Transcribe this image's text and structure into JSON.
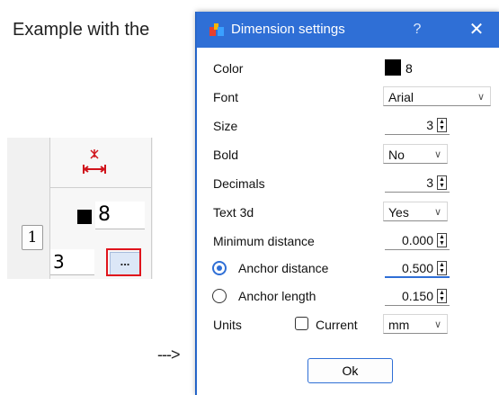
{
  "background": {
    "heading": "Example with the",
    "arrow_text": "--->",
    "table": {
      "row_number": "1",
      "color_value": "8",
      "size_value": "3",
      "more_button": "..."
    }
  },
  "dialog": {
    "title": "Dimension settings",
    "help": "?",
    "close": "✕",
    "rows": {
      "color": {
        "label": "Color",
        "value": "8",
        "swatch_color": "#000000"
      },
      "font": {
        "label": "Font",
        "value": "Arial"
      },
      "size": {
        "label": "Size",
        "value": "3"
      },
      "bold": {
        "label": "Bold",
        "value": "No"
      },
      "decimals": {
        "label": "Decimals",
        "value": "3"
      },
      "text3d": {
        "label": "Text 3d",
        "value": "Yes"
      },
      "min_distance": {
        "label": "Minimum distance",
        "value": "0.000"
      },
      "anchor_distance": {
        "label": "Anchor distance",
        "value": "0.500",
        "selected": true
      },
      "anchor_length": {
        "label": "Anchor length",
        "value": "0.150",
        "selected": false
      },
      "units": {
        "label": "Units",
        "current_label": "Current",
        "current_checked": false,
        "value": "mm"
      }
    },
    "ok": "Ok"
  },
  "colors": {
    "titlebar": "#2f6fd6",
    "highlight": "#e0141c"
  }
}
